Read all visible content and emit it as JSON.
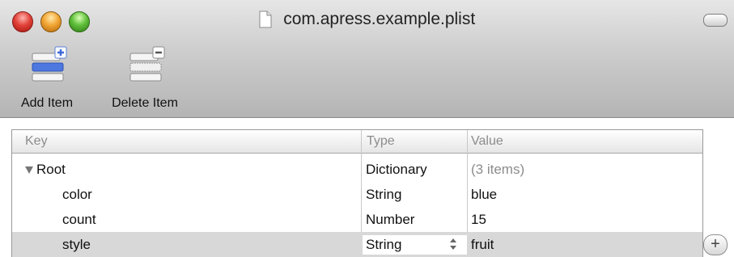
{
  "window": {
    "title": "com.apress.example.plist"
  },
  "toolbar": {
    "add_label": "Add Item",
    "delete_label": "Delete Item"
  },
  "table": {
    "headers": {
      "key": "Key",
      "type": "Type",
      "value": "Value"
    },
    "rows": [
      {
        "key": "Root",
        "type": "Dictionary",
        "value": "(3 items)"
      },
      {
        "key": "color",
        "type": "String",
        "value": "blue"
      },
      {
        "key": "count",
        "type": "Number",
        "value": "15"
      },
      {
        "key": "style",
        "type": "String",
        "value": "fruit"
      }
    ]
  },
  "icons": {
    "close": "close-traffic-light-icon",
    "minimize": "minimize-traffic-light-icon",
    "zoom": "zoom-traffic-light-icon",
    "document": "document-icon",
    "add_item": "add-item-icon",
    "delete_item": "delete-item-icon",
    "disclosure": "disclosure-triangle-down-icon",
    "stepper": "up-down-stepper-icon",
    "add_row": "plus-icon"
  },
  "colors": {
    "selected_row": "#d8d8d8",
    "add_icon_blue": "#3f6ad8"
  }
}
